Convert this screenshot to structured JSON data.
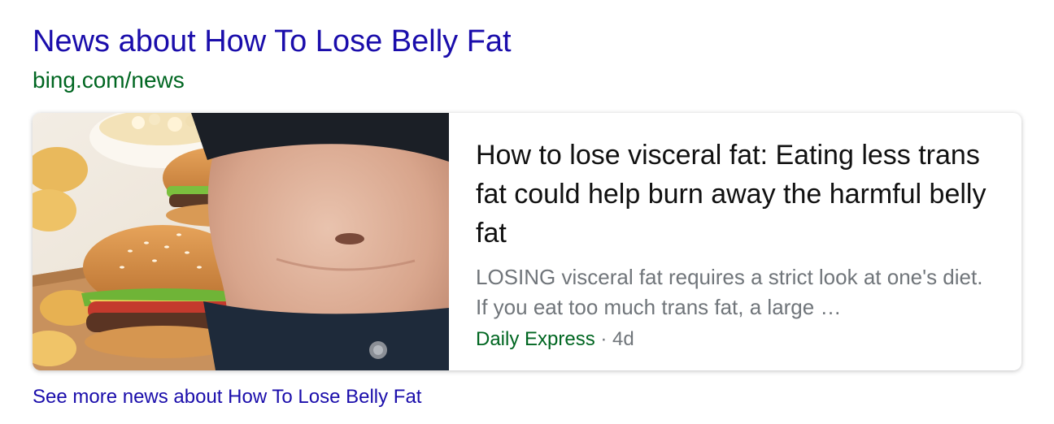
{
  "news_block": {
    "title": "News about How To Lose Belly Fat",
    "url": "bing.com/news",
    "article": {
      "headline": "How to lose visceral fat: Eating less trans fat could help burn away the harmful belly fat",
      "snippet": "LOSING visceral fat requires a strict look at one's diet. If you eat too much trans fat, a large …",
      "source": "Daily Express",
      "separator": " · ",
      "age": "4d",
      "thumbnail_icon": "belly-and-burger-photo"
    },
    "see_more": "See more news about How To Lose Belly Fat"
  },
  "colors": {
    "link": "#1a0dab",
    "url_green": "#006621",
    "snippet_gray": "#70757a",
    "headline": "#111111"
  }
}
